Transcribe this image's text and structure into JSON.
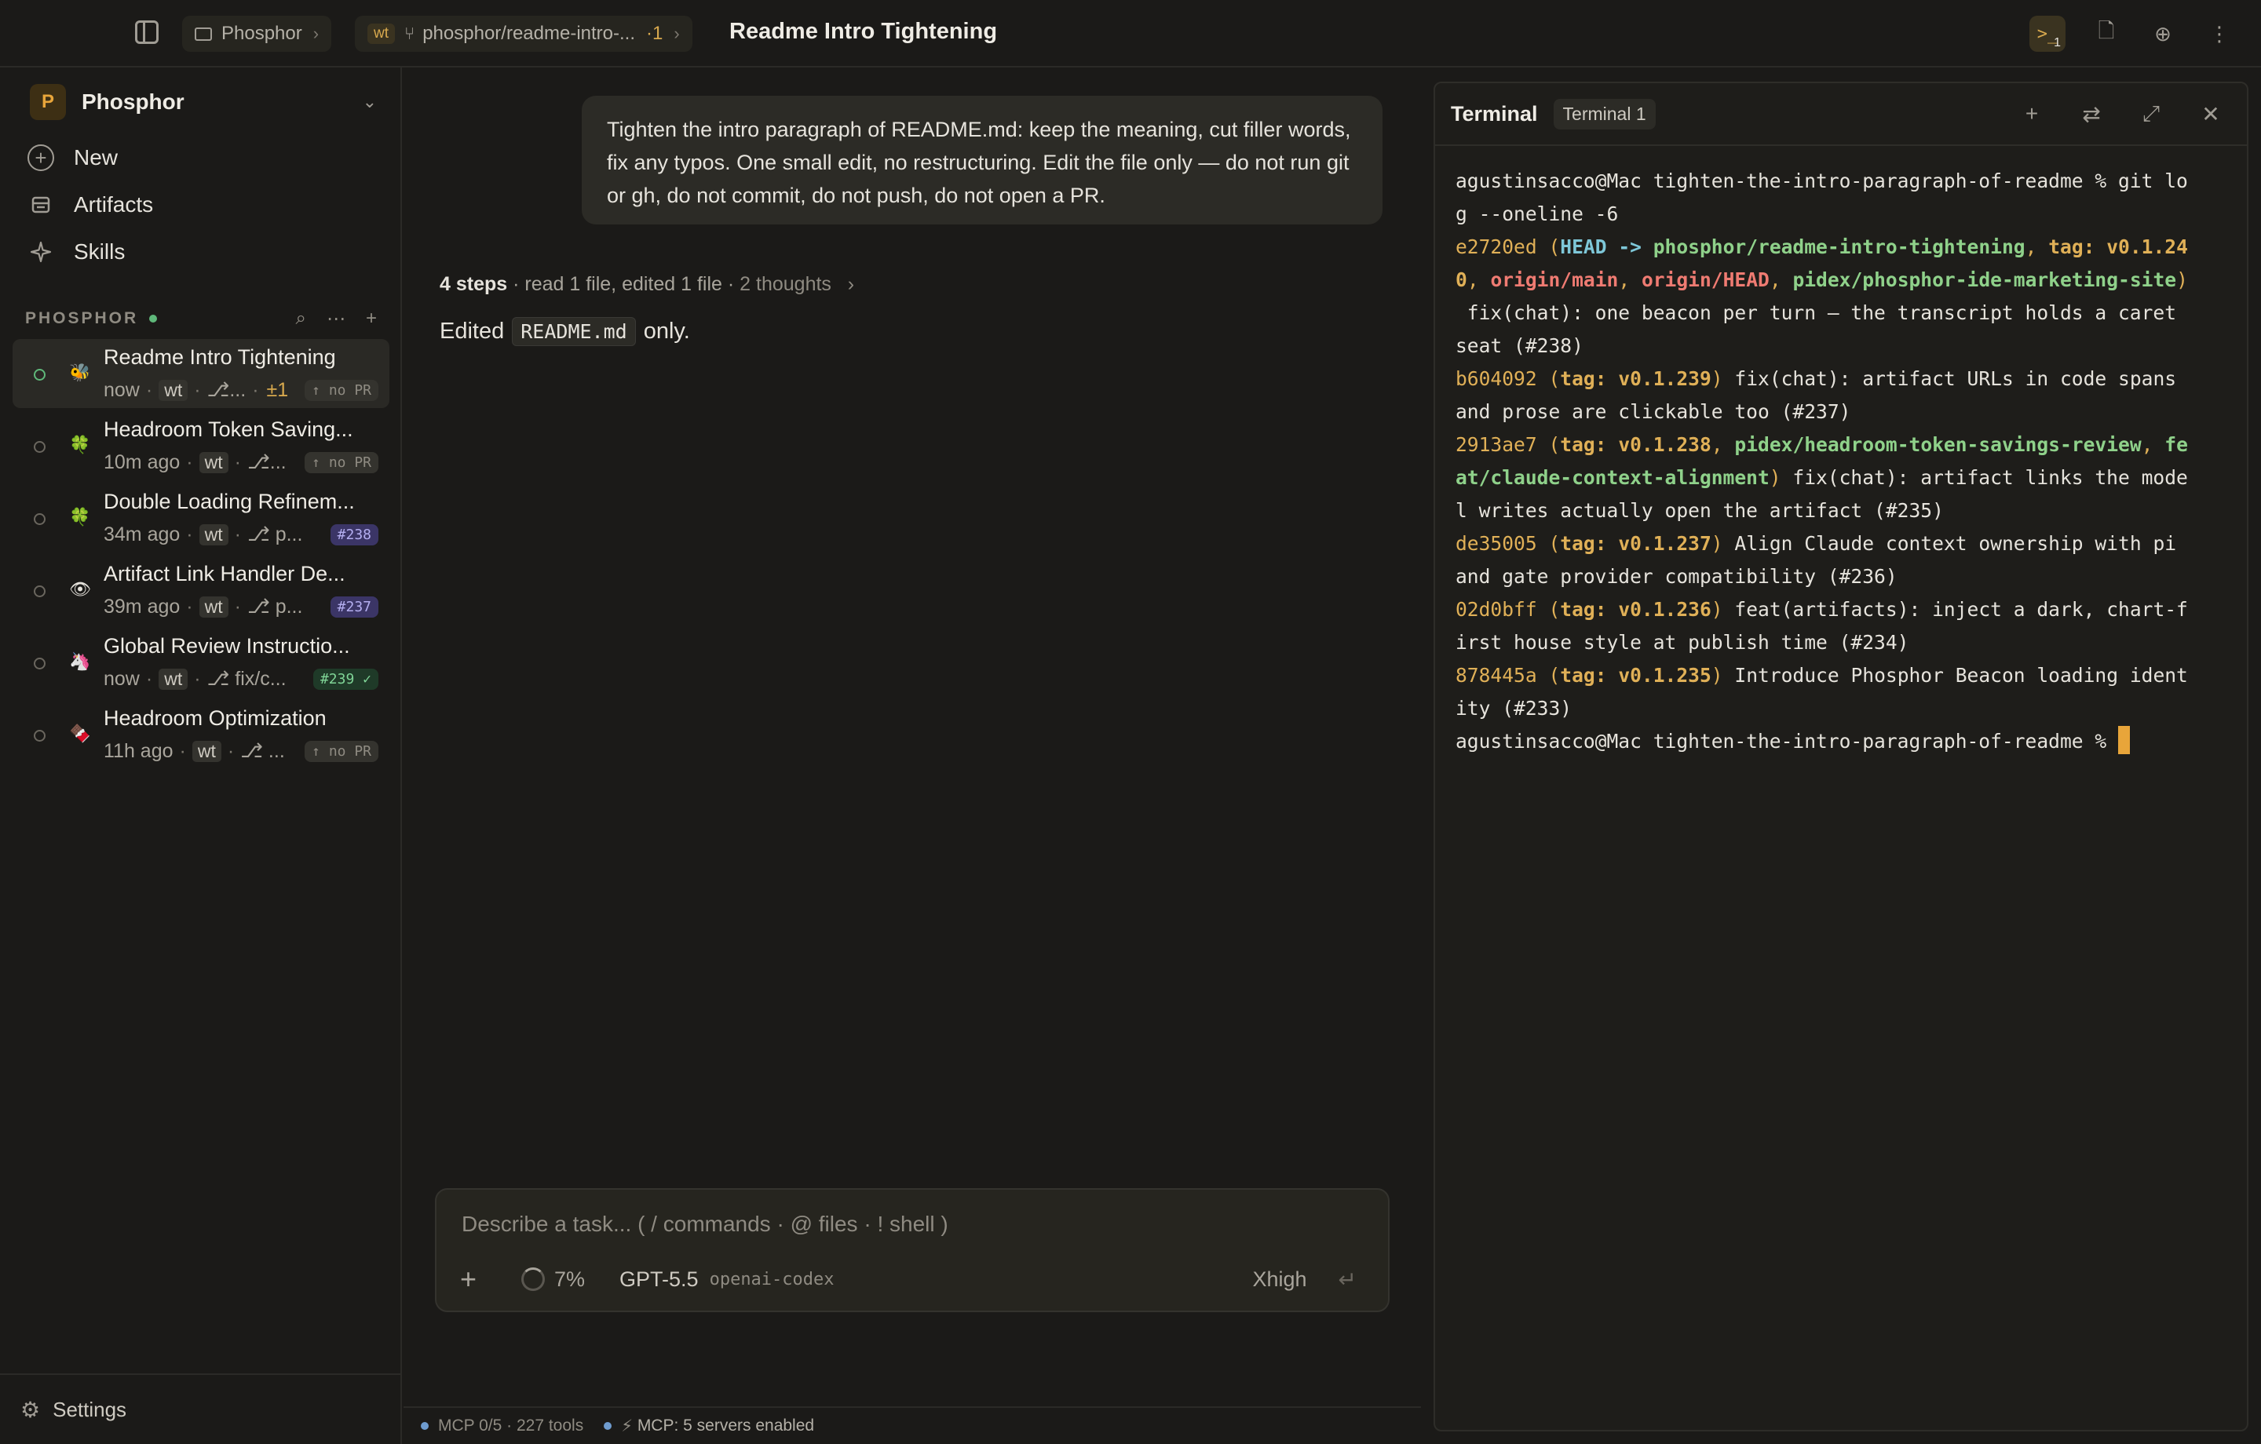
{
  "header": {
    "project_crumb": "Phosphor",
    "worktree_tag": "wt",
    "branch_crumb": "phosphor/readme-intro-...",
    "branch_count": "·1",
    "title": "Readme Intro Tightening",
    "terminal_badge": "1",
    "icons": [
      "sidebar-toggle-icon",
      "folder-icon",
      "branch-icon",
      "terminal-icon",
      "file-icon",
      "globe-icon",
      "more-vertical-icon"
    ]
  },
  "sidebar": {
    "workspace": {
      "avatar": "P",
      "name": "Phosphor"
    },
    "nav": [
      {
        "label": "New",
        "icon": "plus-circle-icon"
      },
      {
        "label": "Artifacts",
        "icon": "artifacts-icon"
      },
      {
        "label": "Skills",
        "icon": "sparkle-icon"
      }
    ],
    "section_title": "PHOSPHOR",
    "sessions": [
      {
        "emoji": "🐝",
        "title": "Readme Intro Tightening",
        "time": "now",
        "wt": "wt",
        "branch": "⎇...",
        "delta": "±1",
        "pr": "↑ no PR",
        "pr_kind": "nopr",
        "active": true
      },
      {
        "emoji": "🍀",
        "title": "Headroom Token Saving...",
        "time": "10m ago",
        "wt": "wt",
        "branch": "⎇...",
        "delta": "",
        "pr": "↑ no PR",
        "pr_kind": "nopr"
      },
      {
        "emoji": "🍀",
        "title": "Double Loading Refinem...",
        "time": "34m ago",
        "wt": "wt",
        "branch": "⎇ p...",
        "delta": "",
        "pr": "#238",
        "pr_kind": "pr"
      },
      {
        "emoji": "👁",
        "title": "Artifact Link Handler De...",
        "time": "39m ago",
        "wt": "wt",
        "branch": "⎇ p...",
        "delta": "",
        "pr": "#237",
        "pr_kind": "pr"
      },
      {
        "emoji": "🦄",
        "title": "Global Review Instructio...",
        "time": "now",
        "wt": "wt",
        "branch": "⎇ fix/c...",
        "delta": "",
        "pr": "#239 ✓",
        "pr_kind": "merged"
      },
      {
        "emoji": "🍫",
        "title": "Headroom Optimization",
        "time": "11h ago",
        "wt": "wt",
        "branch": "⎇ ...",
        "delta": "",
        "pr": "↑ no PR",
        "pr_kind": "nopr"
      }
    ],
    "settings_label": "Settings"
  },
  "chat": {
    "user_message": "Tighten the intro paragraph of README.md: keep the meaning, cut filler words, fix any typos. One small edit, no restructuring. Edit the file only — do not run git or gh, do not commit, do not push, do not open a PR.",
    "steps_count": "4 steps",
    "steps_detail": " · read 1 file, edited 1 file · ",
    "steps_thoughts": "2 thoughts",
    "edited_prefix": "Edited",
    "edited_file": "README.md",
    "edited_suffix": "only."
  },
  "composer": {
    "placeholder": "Describe a task...  ( / commands · @ files · ! shell )",
    "context_pct": "7%",
    "model": "GPT-5.5",
    "provider": "openai-codex",
    "effort": "Xhigh"
  },
  "statusbar": {
    "mcp_tools": "MCP 0/5 · 227 tools",
    "mcp_servers": "MCP: 5 servers enabled"
  },
  "terminal": {
    "title": "Terminal",
    "tab": "Terminal 1",
    "lines": [
      [
        {
          "t": "agustinsacco@Mac tighten-the-intro-paragraph-of-readme % git lo",
          "c": ""
        }
      ],
      [
        {
          "t": "g --oneline -6",
          "c": ""
        }
      ],
      [
        {
          "t": "e2720ed",
          "c": "c-hash"
        },
        {
          "t": " (",
          "c": "c-par"
        },
        {
          "t": "HEAD -> ",
          "c": "c-head"
        },
        {
          "t": "phosphor/readme-intro-tightening",
          "c": "c-brn"
        },
        {
          "t": ", ",
          "c": "c-par"
        },
        {
          "t": "tag: v0.1.24",
          "c": "c-tag"
        }
      ],
      [
        {
          "t": "0",
          "c": "c-tag"
        },
        {
          "t": ", ",
          "c": "c-par"
        },
        {
          "t": "origin/main",
          "c": "c-rem"
        },
        {
          "t": ", ",
          "c": "c-par"
        },
        {
          "t": "origin/HEAD",
          "c": "c-rem"
        },
        {
          "t": ", ",
          "c": "c-par"
        },
        {
          "t": "pidex/phosphor-ide-marketing-site",
          "c": "c-brn"
        },
        {
          "t": ")",
          "c": "c-par"
        }
      ],
      [
        {
          "t": " fix(chat): one beacon per turn — the transcript holds a caret",
          "c": ""
        }
      ],
      [
        {
          "t": "seat (#238)",
          "c": ""
        }
      ],
      [
        {
          "t": "b604092",
          "c": "c-hash"
        },
        {
          "t": " (",
          "c": "c-par"
        },
        {
          "t": "tag: v0.1.239",
          "c": "c-tag"
        },
        {
          "t": ")",
          "c": "c-par"
        },
        {
          "t": " fix(chat): artifact URLs in code spans",
          "c": ""
        }
      ],
      [
        {
          "t": "and prose are clickable too (#237)",
          "c": ""
        }
      ],
      [
        {
          "t": "2913ae7",
          "c": "c-hash"
        },
        {
          "t": " (",
          "c": "c-par"
        },
        {
          "t": "tag: v0.1.238",
          "c": "c-tag"
        },
        {
          "t": ", ",
          "c": "c-par"
        },
        {
          "t": "pidex/headroom-token-savings-review",
          "c": "c-brn"
        },
        {
          "t": ", ",
          "c": "c-par"
        },
        {
          "t": "fe",
          "c": "c-brn"
        }
      ],
      [
        {
          "t": "at/claude-context-alignment",
          "c": "c-brn"
        },
        {
          "t": ")",
          "c": "c-par"
        },
        {
          "t": " fix(chat): artifact links the mode",
          "c": ""
        }
      ],
      [
        {
          "t": "l writes actually open the artifact (#235)",
          "c": ""
        }
      ],
      [
        {
          "t": "de35005",
          "c": "c-hash"
        },
        {
          "t": " (",
          "c": "c-par"
        },
        {
          "t": "tag: v0.1.237",
          "c": "c-tag"
        },
        {
          "t": ")",
          "c": "c-par"
        },
        {
          "t": " Align Claude context ownership with pi",
          "c": ""
        }
      ],
      [
        {
          "t": "and gate provider compatibility (#236)",
          "c": ""
        }
      ],
      [
        {
          "t": "02d0bff",
          "c": "c-hash"
        },
        {
          "t": " (",
          "c": "c-par"
        },
        {
          "t": "tag: v0.1.236",
          "c": "c-tag"
        },
        {
          "t": ")",
          "c": "c-par"
        },
        {
          "t": " feat(artifacts): inject a dark, chart-f",
          "c": ""
        }
      ],
      [
        {
          "t": "irst house style at publish time (#234)",
          "c": ""
        }
      ],
      [
        {
          "t": "878445a",
          "c": "c-hash"
        },
        {
          "t": " (",
          "c": "c-par"
        },
        {
          "t": "tag: v0.1.235",
          "c": "c-tag"
        },
        {
          "t": ")",
          "c": "c-par"
        },
        {
          "t": " Introduce Phosphor Beacon loading ident",
          "c": ""
        }
      ],
      [
        {
          "t": "ity (#233)",
          "c": ""
        }
      ],
      [
        {
          "t": "agustinsacco@Mac tighten-the-intro-paragraph-of-readme % ",
          "c": ""
        }
      ]
    ]
  }
}
